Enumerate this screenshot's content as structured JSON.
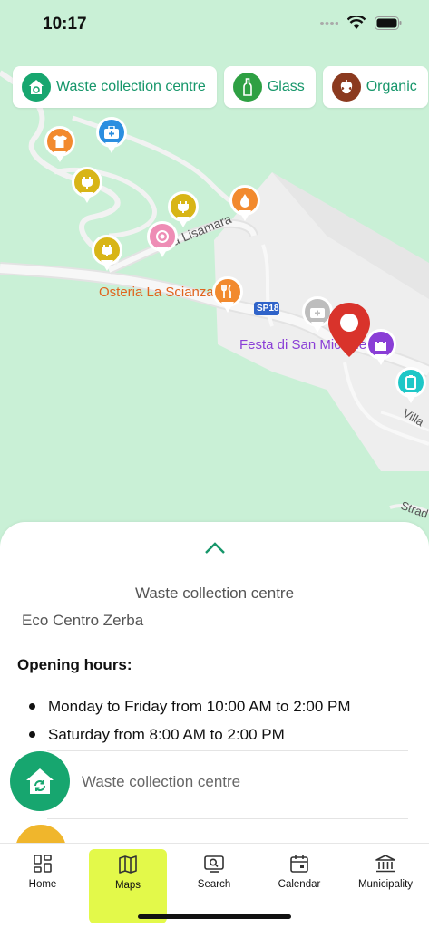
{
  "status": {
    "time": "10:17"
  },
  "chips": [
    {
      "label": "Waste collection centre",
      "color": "#17a66f",
      "icon": "recycle-house-icon"
    },
    {
      "label": "Glass",
      "color": "#2ea043",
      "icon": "bottle-icon"
    },
    {
      "label": "Organic",
      "color": "#8b3a1f",
      "icon": "apple-core-icon"
    }
  ],
  "map": {
    "labels": {
      "villa_lisamara": "Villa Lisamara",
      "osteria": "Osteria La Scianza",
      "sp18": "SP18",
      "festa": "Festa di San Michele",
      "villa_right": "Villa",
      "strada": "Strad"
    }
  },
  "sheet": {
    "title": "Waste collection centre",
    "subtitle": "Eco Centro Zerba",
    "hours_heading": "Opening hours:",
    "hours": [
      "Monday to Friday from 10:00 AM to 2:00 PM",
      "Saturday from 8:00 AM to 2:00 PM"
    ],
    "list_item": "Waste collection centre"
  },
  "tabs": [
    {
      "label": "Home",
      "icon": "grid-icon"
    },
    {
      "label": "Maps",
      "icon": "map-icon",
      "active": true
    },
    {
      "label": "Search",
      "icon": "search-icon"
    },
    {
      "label": "Calendar",
      "icon": "calendar-icon"
    },
    {
      "label": "Municipality",
      "icon": "bank-icon"
    }
  ],
  "colors": {
    "accent": "#16966a",
    "map_bg": "#c9f0d6",
    "active_tab": "#e3f94a",
    "marker": "#d9332b"
  }
}
